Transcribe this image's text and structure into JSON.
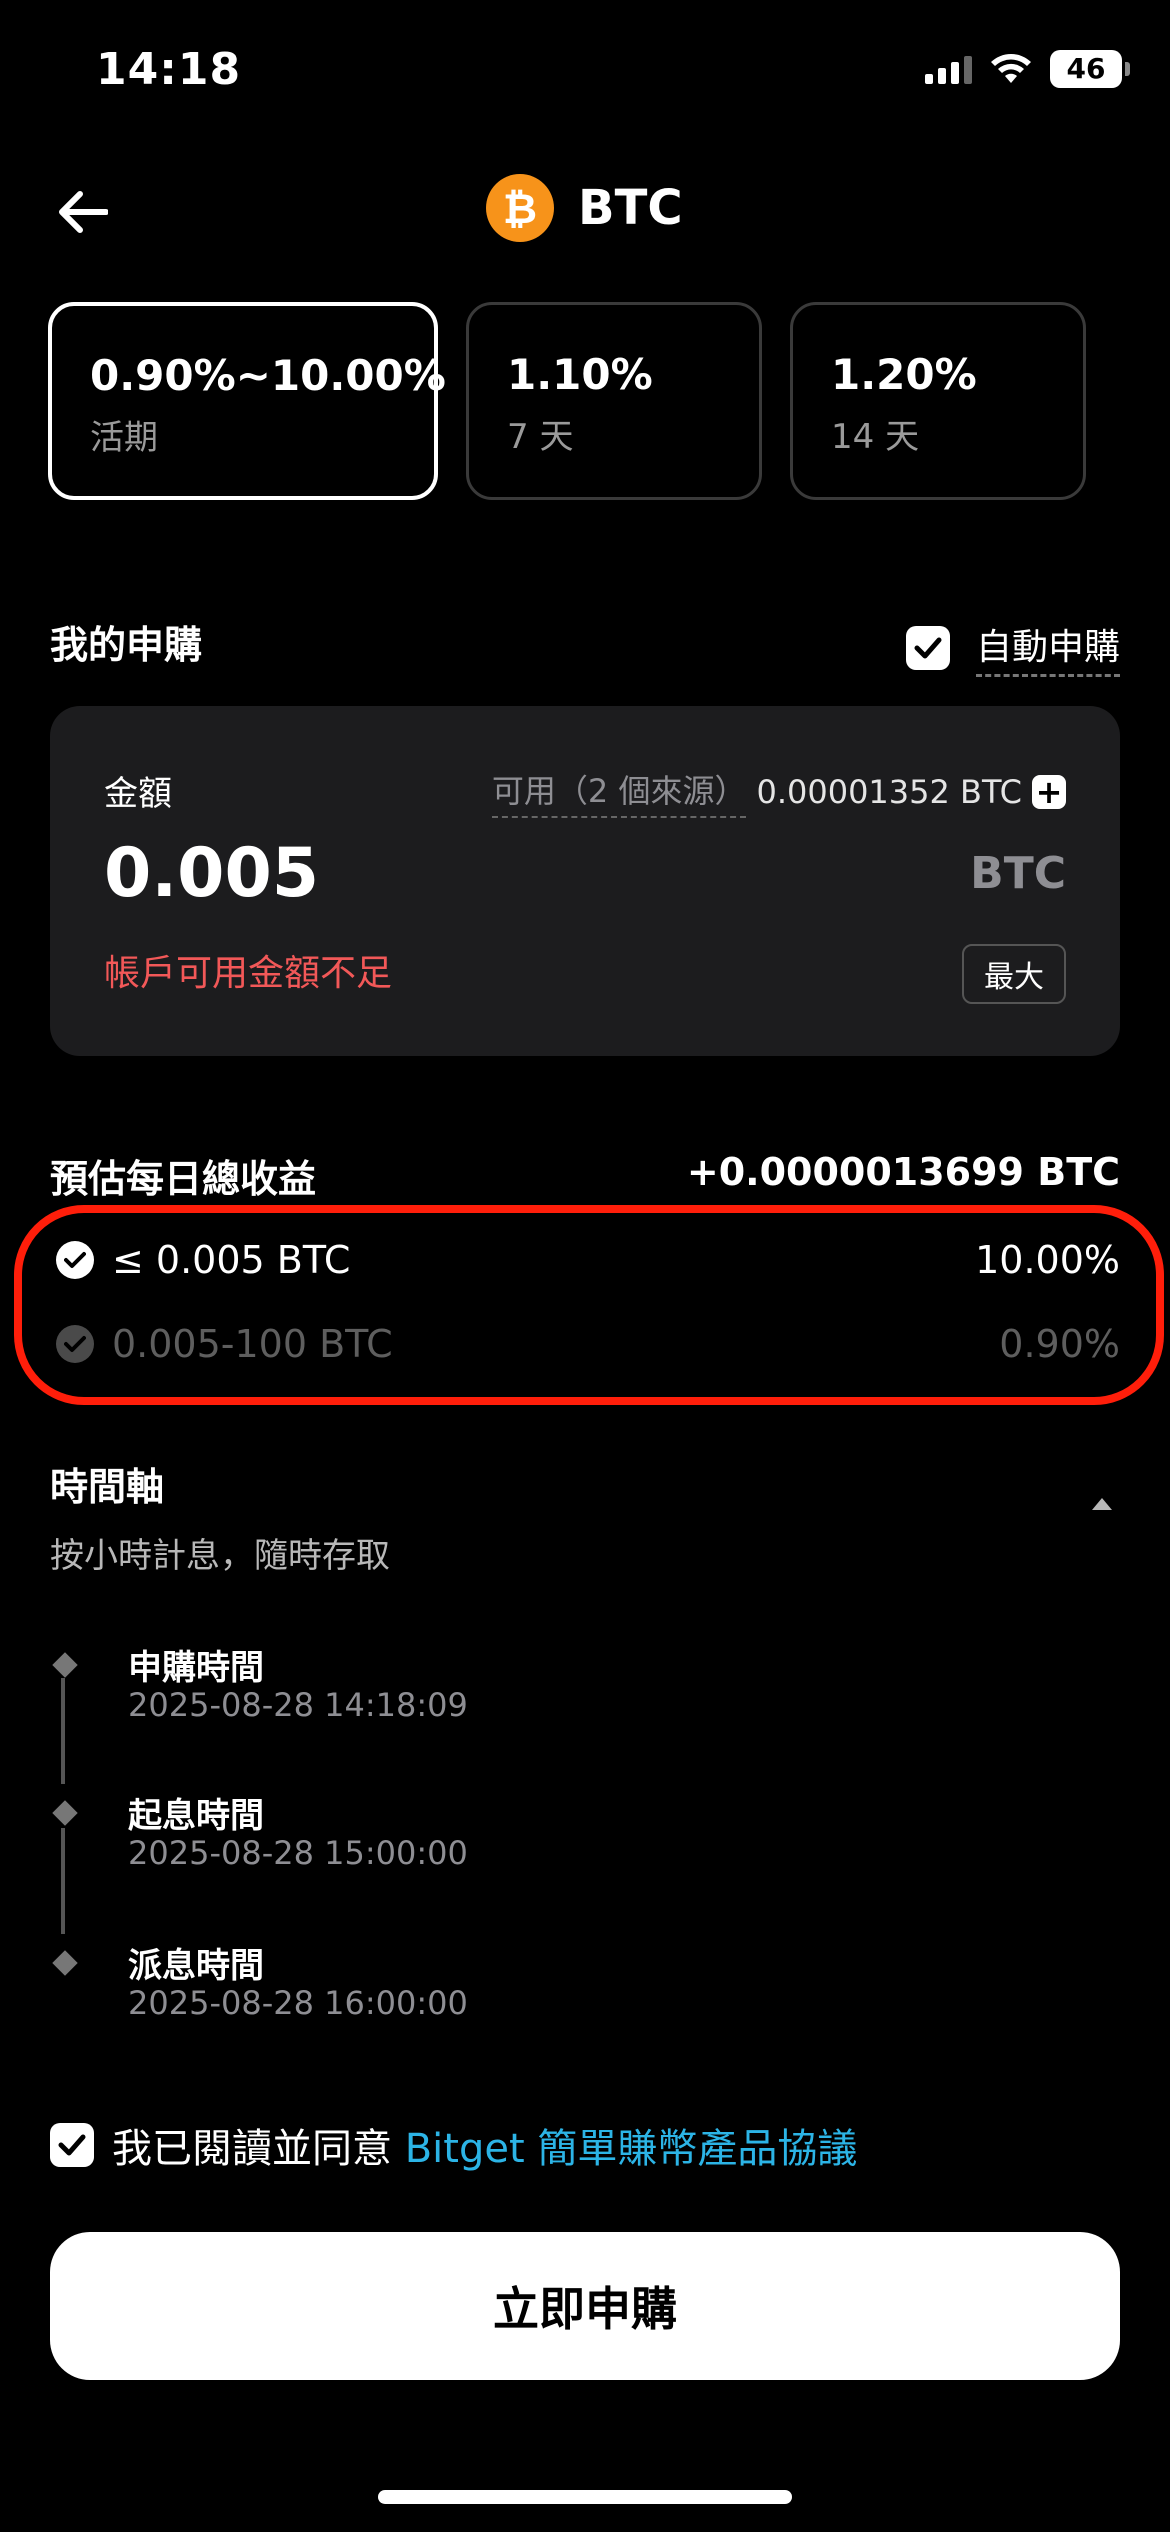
{
  "status_bar": {
    "time": "14:18",
    "battery": "46"
  },
  "header": {
    "title": "BTC",
    "coin_symbol": "₿"
  },
  "plans": [
    {
      "rate": "0.90%~10.00%",
      "term": "活期",
      "selected": true
    },
    {
      "rate": "1.10%",
      "term": "7 天",
      "selected": false
    },
    {
      "rate": "1.20%",
      "term": "14 天",
      "selected": false
    }
  ],
  "subscription": {
    "title": "我的申購",
    "auto_label": "自動申購",
    "auto_checked": true
  },
  "amount": {
    "label": "金額",
    "available_label": "可用（2 個來源）",
    "available_value": "0.00001352 BTC",
    "value": "0.005",
    "unit": "BTC",
    "error": "帳戶可用金額不足",
    "max_label": "最大"
  },
  "earnings": {
    "title": "預估每日總收益",
    "value": "+0.0000013699 BTC",
    "tiers": [
      {
        "range": "≤ 0.005 BTC",
        "rate": "10.00%",
        "active": true
      },
      {
        "range": "0.005-100 BTC",
        "rate": "0.90%",
        "active": false
      }
    ]
  },
  "timeline": {
    "title": "時間軸",
    "subtitle": "按小時計息，隨時存取",
    "items": [
      {
        "title": "申購時間",
        "time": "2025-08-28 14:18:09"
      },
      {
        "title": "起息時間",
        "time": "2025-08-28 15:00:00"
      },
      {
        "title": "派息時間",
        "time": "2025-08-28 16:00:00"
      }
    ]
  },
  "agreement": {
    "prefix": "我已閱讀並同意 ",
    "link": "Bitget 簡單賺幣產品協議",
    "checked": true
  },
  "cta": {
    "label": "立即申購"
  },
  "colors": {
    "accent_link": "#2cb4e6",
    "error": "#f25858",
    "highlight": "#ff1e0a",
    "btc": "#f7931a"
  }
}
